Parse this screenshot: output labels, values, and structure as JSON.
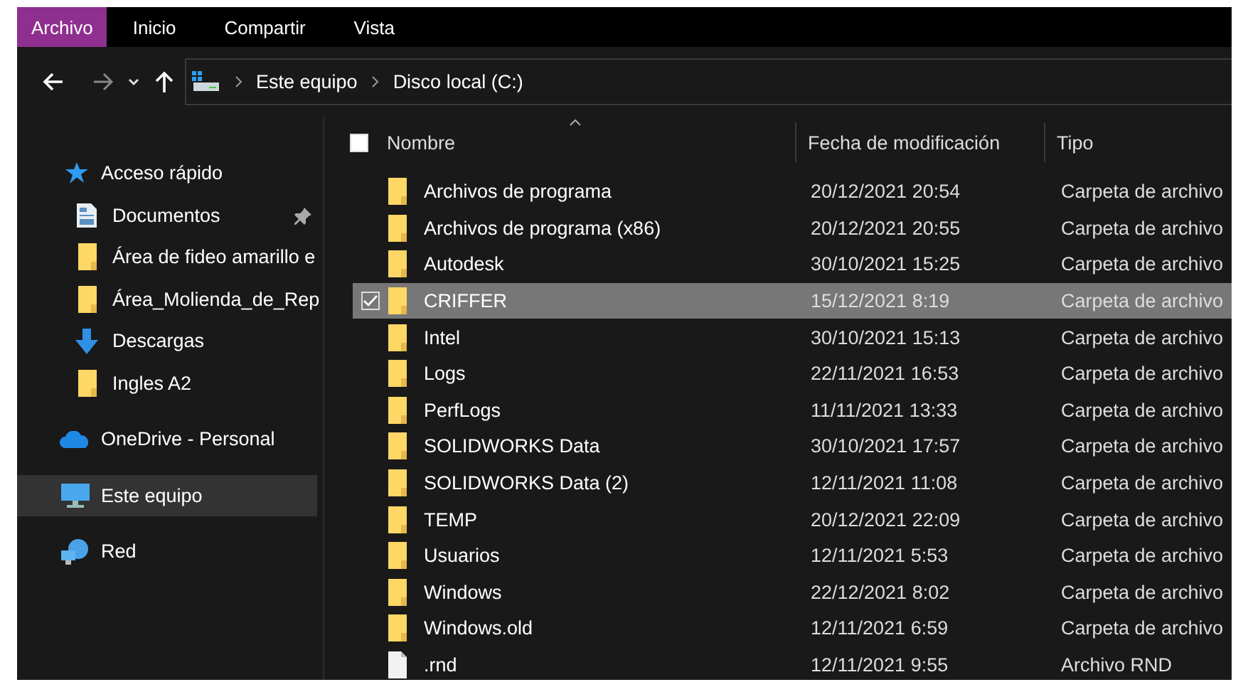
{
  "ribbon": {
    "tabs": [
      {
        "label": "Archivo",
        "selected": true
      },
      {
        "label": "Inicio",
        "selected": false
      },
      {
        "label": "Compartir",
        "selected": false
      },
      {
        "label": "Vista",
        "selected": false
      }
    ]
  },
  "address": {
    "path": [
      "Este equipo",
      "Disco local (C:)"
    ]
  },
  "sidebar": {
    "items": [
      {
        "label": "Acceso rápido",
        "kind": "star",
        "selected": false,
        "children": [
          {
            "label": "Documentos",
            "kind": "document",
            "selected": false,
            "pinned": true
          },
          {
            "label": "Área de fideo amarillo e",
            "kind": "folder",
            "selected": false,
            "pinned": false
          },
          {
            "label": "Área_Molienda_de_Rep",
            "kind": "folder",
            "selected": false,
            "pinned": false
          },
          {
            "label": "Descargas",
            "kind": "download",
            "selected": false,
            "pinned": false
          },
          {
            "label": "Ingles A2",
            "kind": "folder",
            "selected": false,
            "pinned": false
          }
        ]
      },
      {
        "label": "OneDrive - Personal",
        "kind": "cloud",
        "selected": false
      },
      {
        "label": "Este equipo",
        "kind": "computer",
        "selected": true
      },
      {
        "label": "Red",
        "kind": "network",
        "selected": false
      }
    ]
  },
  "table": {
    "select_all_checked": false,
    "columns": [
      "Nombre",
      "Fecha de modificación",
      "Tipo"
    ],
    "rows": [
      {
        "name": "Archivos de programa",
        "date": "20/12/2021 20:54",
        "type": "Carpeta de archivo",
        "kind": "folder",
        "selected": false
      },
      {
        "name": "Archivos de programa (x86)",
        "date": "20/12/2021 20:55",
        "type": "Carpeta de archivo",
        "kind": "folder",
        "selected": false
      },
      {
        "name": "Autodesk",
        "date": "30/10/2021 15:25",
        "type": "Carpeta de archivo",
        "kind": "folder",
        "selected": false
      },
      {
        "name": "CRIFFER",
        "date": "15/12/2021 8:19",
        "type": "Carpeta de archivo",
        "kind": "folder",
        "selected": true
      },
      {
        "name": "Intel",
        "date": "30/10/2021 15:13",
        "type": "Carpeta de archivo",
        "kind": "folder",
        "selected": false
      },
      {
        "name": "Logs",
        "date": "22/11/2021 16:53",
        "type": "Carpeta de archivo",
        "kind": "folder",
        "selected": false
      },
      {
        "name": "PerfLogs",
        "date": "11/11/2021 13:33",
        "type": "Carpeta de archivo",
        "kind": "folder",
        "selected": false
      },
      {
        "name": "SOLIDWORKS Data",
        "date": "30/10/2021 17:57",
        "type": "Carpeta de archivo",
        "kind": "folder",
        "selected": false
      },
      {
        "name": "SOLIDWORKS Data (2)",
        "date": "12/11/2021 11:08",
        "type": "Carpeta de archivo",
        "kind": "folder",
        "selected": false
      },
      {
        "name": "TEMP",
        "date": "20/12/2021 22:09",
        "type": "Carpeta de archivo",
        "kind": "folder",
        "selected": false
      },
      {
        "name": "Usuarios",
        "date": "12/11/2021 5:53",
        "type": "Carpeta de archivo",
        "kind": "folder",
        "selected": false
      },
      {
        "name": "Windows",
        "date": "22/12/2021 8:02",
        "type": "Carpeta de archivo",
        "kind": "folder",
        "selected": false
      },
      {
        "name": "Windows.old",
        "date": "12/11/2021 6:59",
        "type": "Carpeta de archivo",
        "kind": "folder",
        "selected": false
      },
      {
        "name": ".rnd",
        "date": "12/11/2021 9:55",
        "type": "Archivo RND",
        "kind": "file",
        "selected": false
      }
    ]
  }
}
